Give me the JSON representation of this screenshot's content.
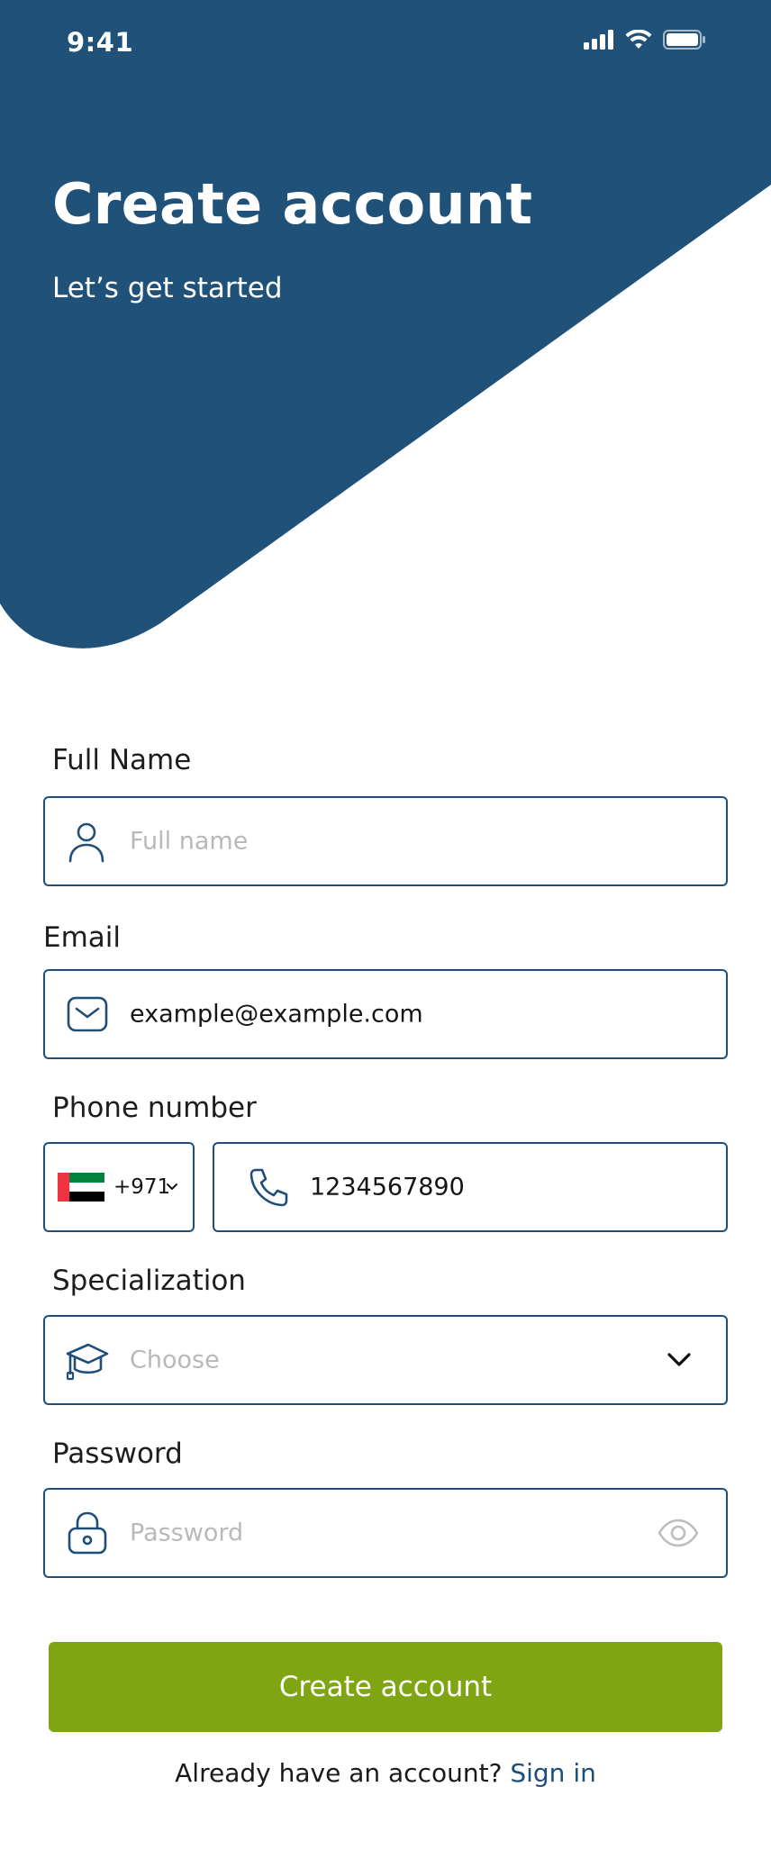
{
  "status": {
    "time": "9:41"
  },
  "header": {
    "title": "Create account",
    "subtitle": "Let’s get started"
  },
  "form": {
    "full_name": {
      "label": "Full Name",
      "placeholder": "Full name",
      "icon": "user-icon"
    },
    "email": {
      "label": "Email",
      "value": "example@example.com",
      "icon": "mail-icon"
    },
    "phone": {
      "label": "Phone number",
      "country_code": "+971",
      "country_flag": "uae-flag-icon",
      "value": "1234567890",
      "icon": "phone-icon"
    },
    "specialization": {
      "label": "Specialization",
      "placeholder": "Choose",
      "icon": "graduation-cap-icon"
    },
    "password": {
      "label": "Password",
      "placeholder": "Password",
      "icon": "lock-icon",
      "toggle_icon": "eye-icon"
    }
  },
  "actions": {
    "submit_label": "Create account",
    "signin_prompt": "Already have an account?",
    "signin_link": "Sign in"
  },
  "colors": {
    "primary": "#1f4e79",
    "accent": "#80a512",
    "placeholder": "#b9b9b9"
  }
}
